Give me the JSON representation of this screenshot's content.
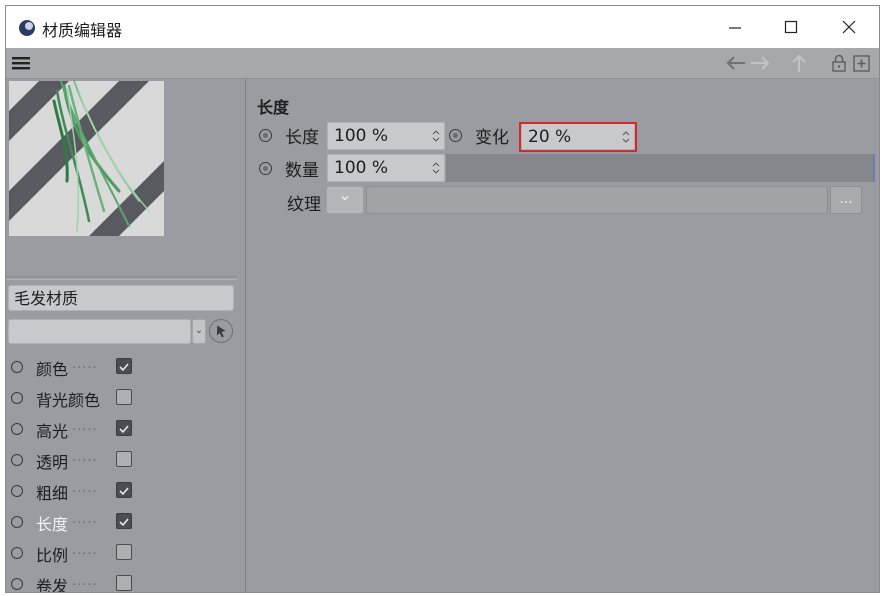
{
  "window": {
    "title": "材质编辑器"
  },
  "material": {
    "name": "毛发材质"
  },
  "channels": [
    {
      "label": "颜色",
      "dots": ".....",
      "checked": true
    },
    {
      "label": "背光颜色",
      "dots": "",
      "checked": false
    },
    {
      "label": "高光",
      "dots": ".....",
      "checked": true
    },
    {
      "label": "透明",
      "dots": ".....",
      "checked": false
    },
    {
      "label": "粗细",
      "dots": ".....",
      "checked": true
    },
    {
      "label": "长度",
      "dots": ".....",
      "checked": true,
      "active": true
    },
    {
      "label": "比例",
      "dots": ".....",
      "checked": false
    },
    {
      "label": "卷发",
      "dots": ".....",
      "checked": false
    }
  ],
  "section": {
    "title": "长度",
    "length": {
      "label": "长度",
      "value": "100 %"
    },
    "variation": {
      "label": "变化",
      "value": "20 %"
    },
    "amount": {
      "label": "数量",
      "value": "100 %"
    },
    "texture": {
      "label": "纹理",
      "more": "..."
    }
  },
  "colors": {
    "panel": "#9b9ca1",
    "field": "#c8c9cc",
    "highlight": "#d42a2a",
    "active_label": "#f2f2f2"
  }
}
